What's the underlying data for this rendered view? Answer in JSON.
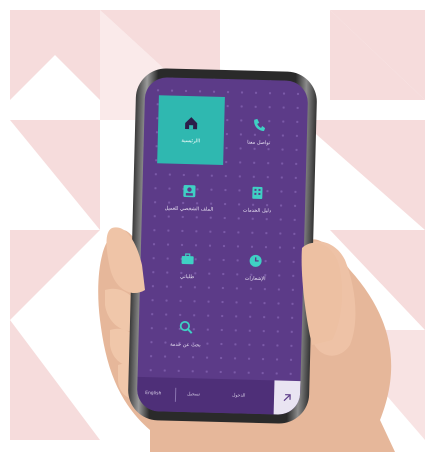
{
  "colors": {
    "screen_bg": "#5c3b88",
    "tile_active": "#2fb8b0",
    "accent_icon": "#3fd0c4",
    "bg_triangles": "#f6dcdc"
  },
  "tiles": [
    {
      "label": "ا‌الرئيسية",
      "icon": "home-icon",
      "active": true
    },
    {
      "label": "تواصل معنا",
      "icon": "phone-icon",
      "active": false
    },
    {
      "label": "الملف الشخصي للعميل",
      "icon": "profile-icon",
      "active": false
    },
    {
      "label": "دليل الخدمات",
      "icon": "directory-icon",
      "active": false
    },
    {
      "label": "طلباتي",
      "icon": "briefcase-icon",
      "active": false
    },
    {
      "label": "الإشعارات",
      "icon": "clock-icon",
      "active": false
    },
    {
      "label": "بحث عن خدمة",
      "icon": "search-icon",
      "active": false
    }
  ],
  "bottom_bar": {
    "items": [
      "English",
      "تسجيل",
      "الدخول"
    ],
    "corner_icon": "collapse-icon"
  }
}
